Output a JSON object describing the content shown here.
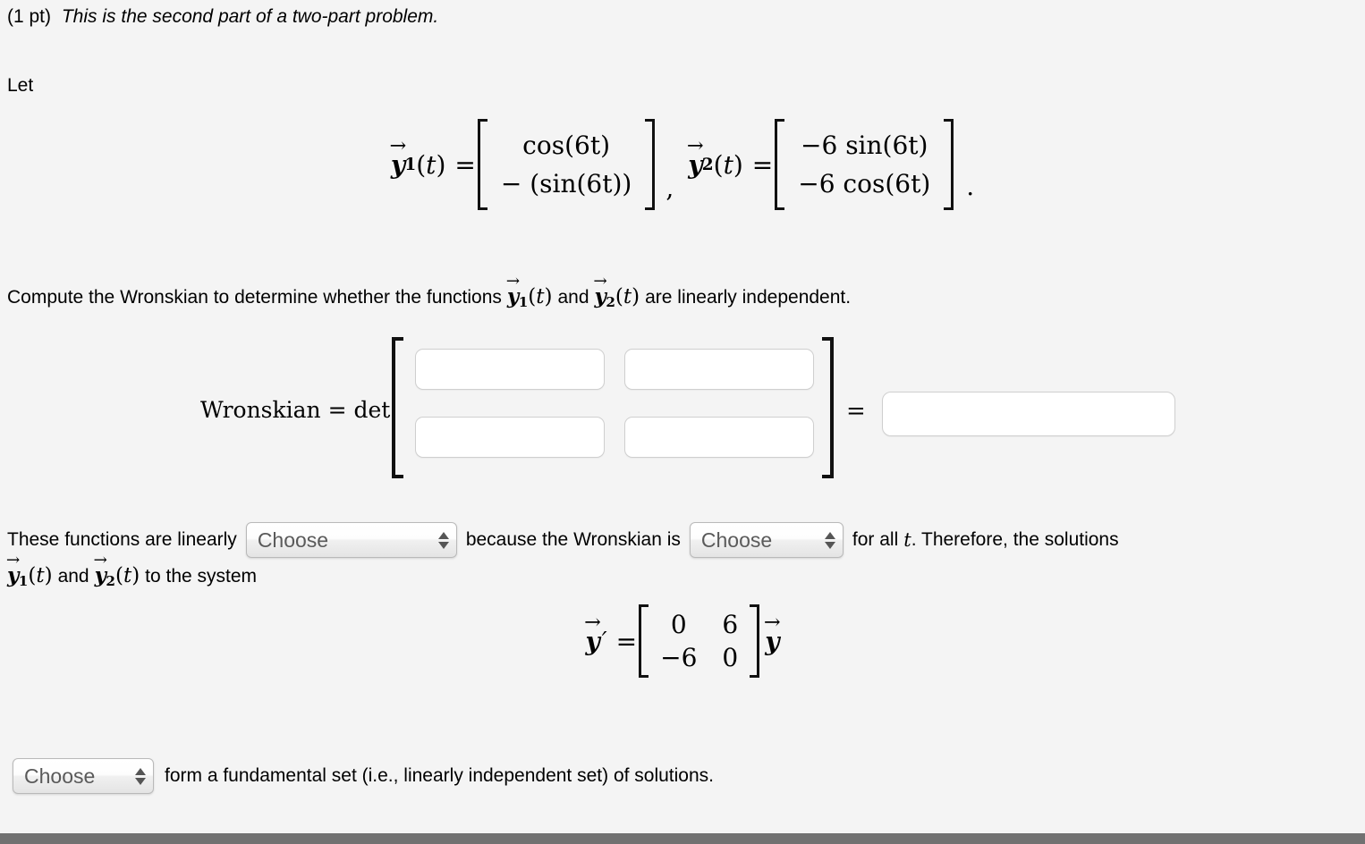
{
  "problem": {
    "points_label": "(1 pt)",
    "instruction_italic": "This is the second part of a two-part problem.",
    "let_label": "Let",
    "y1_name": "y",
    "y1_sub": "1",
    "y1_arg": "(t)",
    "y1_row1": "cos(6t)",
    "y1_row2": "− (sin(6t))",
    "y2_name": "y",
    "y2_sub": "2",
    "y2_arg": "(t)",
    "y2_row1": "−6 sin(6t)",
    "y2_row2": "−6 cos(6t)",
    "equals": "=",
    "comma": ",",
    "period": "."
  },
  "compute": {
    "text_before": "Compute the Wronskian to determine whether the functions",
    "and_text": "and",
    "text_after": "are linearly independent."
  },
  "wronskian": {
    "label": "Wronskian = det",
    "equals": "=",
    "entry_11": "",
    "entry_12": "",
    "entry_21": "",
    "entry_22": "",
    "result": "",
    "placeholder": ""
  },
  "conclusion": {
    "text_1": "These functions are linearly",
    "select_linearly_value": "Choose",
    "text_2": "because the Wronskian is",
    "select_wronskian_value": "Choose",
    "text_3": "for all",
    "t_var": "t",
    "text_4": ". Therefore, the solutions",
    "line2_and": "and",
    "line2_tail": "to the system"
  },
  "system": {
    "y_name": "y",
    "prime": "′",
    "equals": "=",
    "matrix": [
      [
        "0",
        "6"
      ],
      [
        "−6",
        "0"
      ]
    ],
    "y_right": "y"
  },
  "final": {
    "select_fundamental_value": "Choose",
    "text": "form a fundamental set (i.e., linearly independent set) of solutions."
  },
  "colors": {
    "page_background": "#f4f4f4",
    "input_border": "#cfcfcf",
    "input_background": "#ffffff",
    "select_text": "#5a5a5a",
    "bottom_bar": "#717171",
    "text": "#000000"
  },
  "chart_data": null
}
